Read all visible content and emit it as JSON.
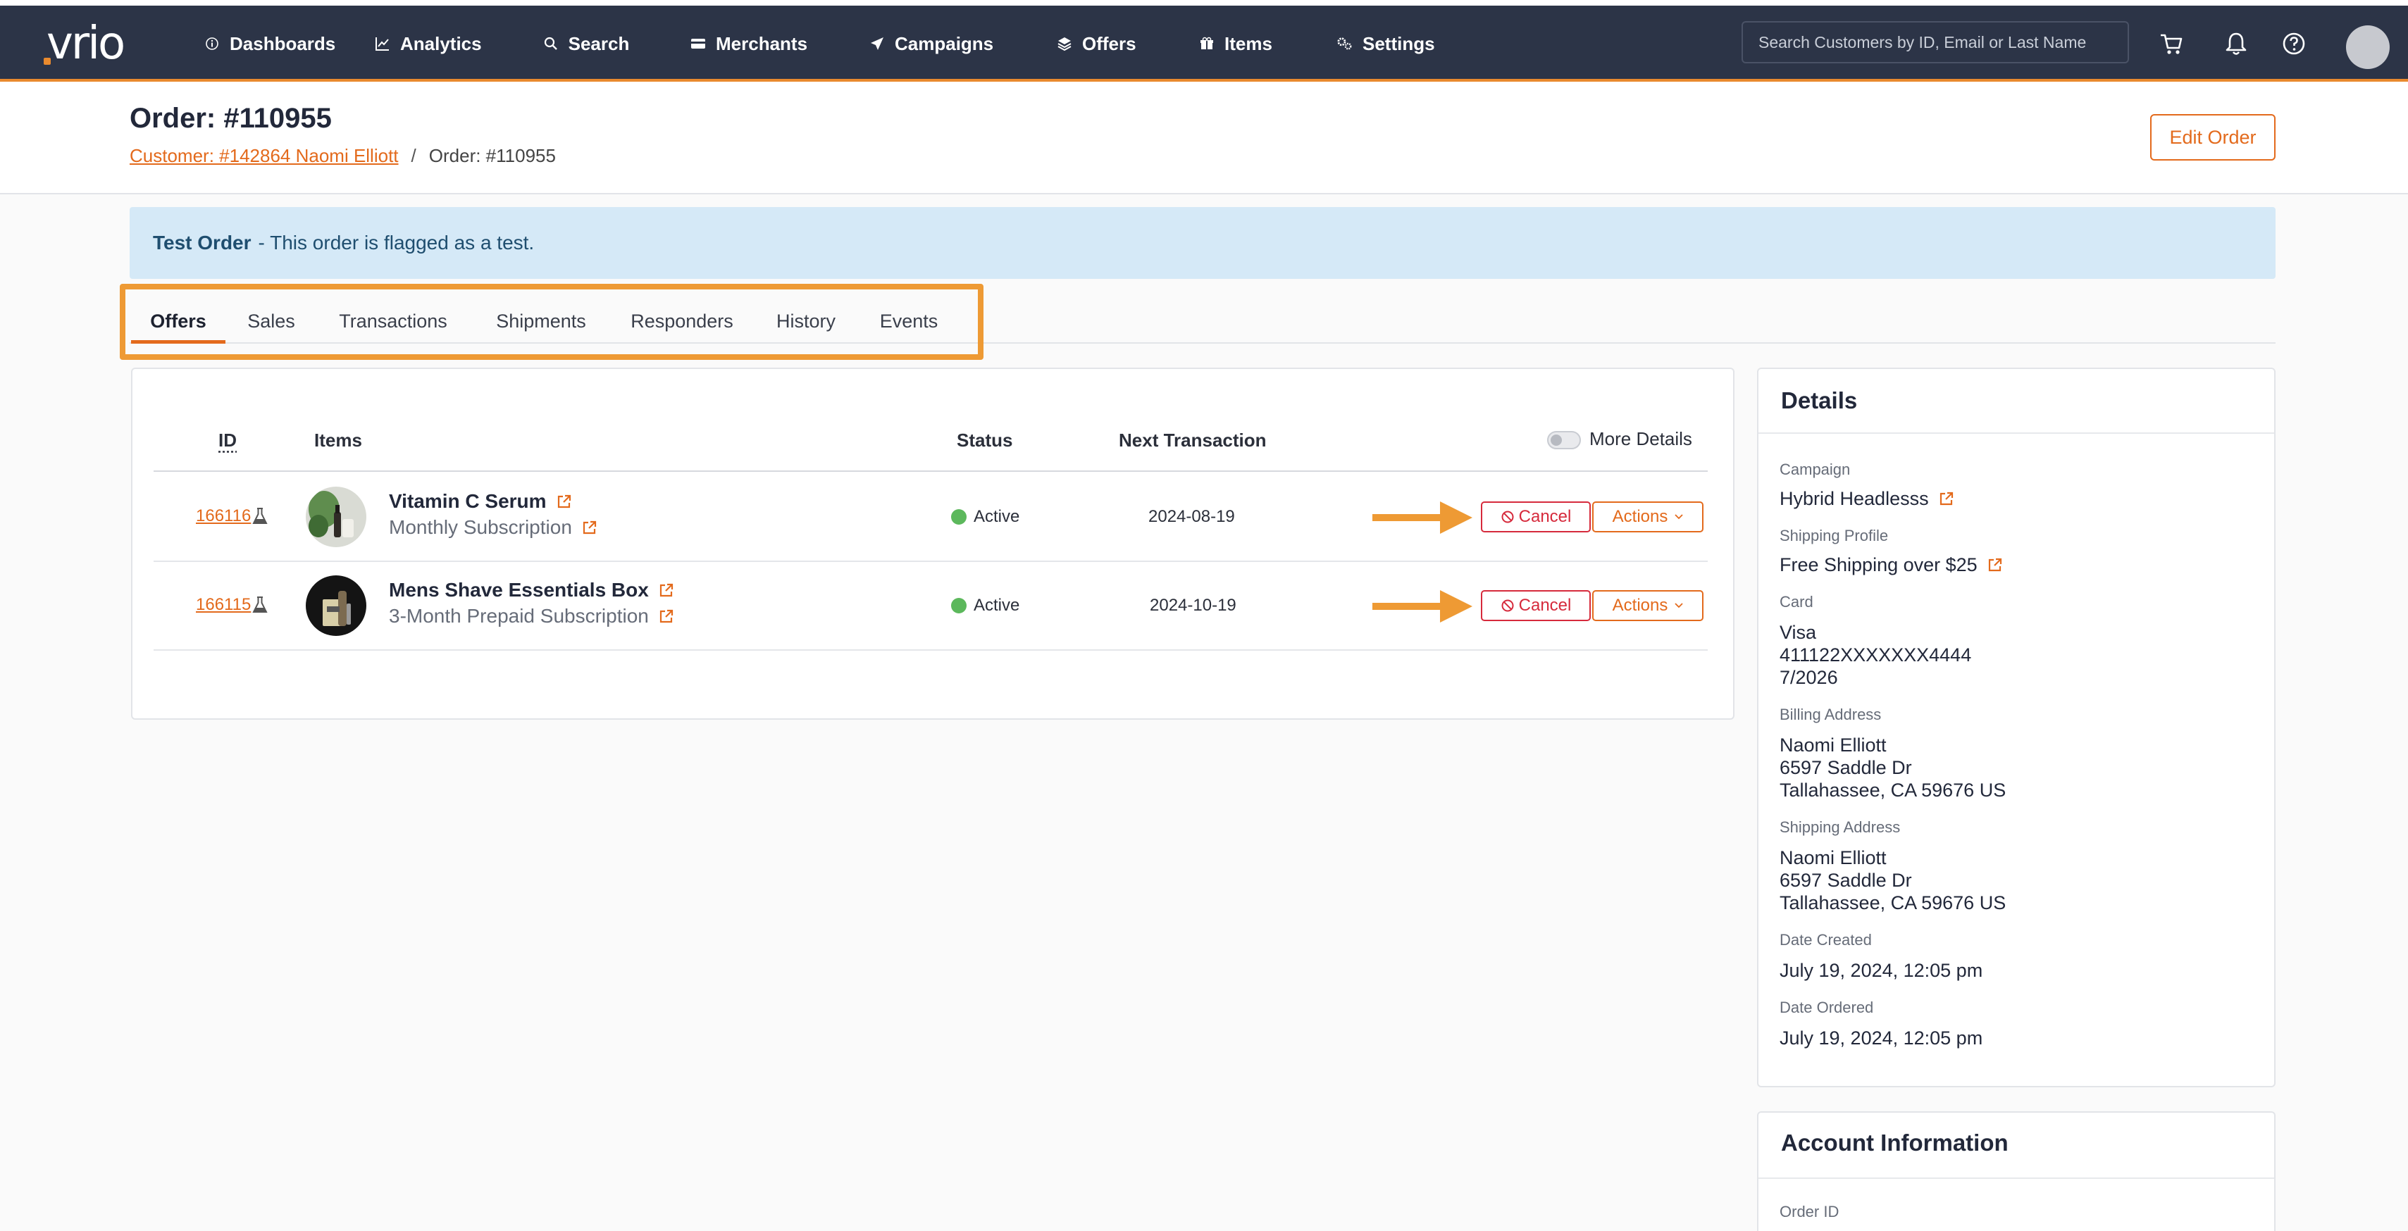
{
  "nav": {
    "logo": "vrio",
    "items": [
      {
        "label": "Dashboards",
        "icon": "info-circle-icon"
      },
      {
        "label": "Analytics",
        "icon": "line-chart-icon"
      },
      {
        "label": "Search",
        "icon": "search-icon"
      },
      {
        "label": "Merchants",
        "icon": "credit-card-icon"
      },
      {
        "label": "Campaigns",
        "icon": "paper-plane-icon"
      },
      {
        "label": "Offers",
        "icon": "layers-icon"
      },
      {
        "label": "Items",
        "icon": "gift-icon"
      },
      {
        "label": "Settings",
        "icon": "gears-icon"
      }
    ],
    "active": "Search",
    "search_placeholder": "Search Customers by ID, Email or Last Name"
  },
  "header": {
    "title": "Order: #110955",
    "breadcrumb_customer": "Customer: #142864 Naomi Elliott",
    "breadcrumb_separator": "/",
    "breadcrumb_current": "Order: #110955",
    "edit_label": "Edit Order"
  },
  "alert": {
    "bold": "Test Order",
    "text": "- This order is flagged as a test."
  },
  "tabs": [
    "Offers",
    "Sales",
    "Transactions",
    "Shipments",
    "Responders",
    "History",
    "Events"
  ],
  "active_tab": "Offers",
  "offers_table": {
    "headers": {
      "id": "ID",
      "items": "Items",
      "status": "Status",
      "next": "Next Transaction"
    },
    "more_details": "More Details",
    "rows": [
      {
        "id": "166116",
        "name": "Vitamin C Serum",
        "subscription": "Monthly Subscription",
        "status": "Active",
        "next": "2024-08-19",
        "cancel": "Cancel",
        "actions": "Actions"
      },
      {
        "id": "166115",
        "name": "Mens Shave Essentials Box",
        "subscription": "3-Month Prepaid Subscription",
        "status": "Active",
        "next": "2024-10-19",
        "cancel": "Cancel",
        "actions": "Actions"
      }
    ]
  },
  "details": {
    "title": "Details",
    "campaign_label": "Campaign",
    "campaign": "Hybrid Headlesss",
    "shipping_profile_label": "Shipping Profile",
    "shipping_profile": "Free Shipping over $25",
    "card_label": "Card",
    "card_type": "Visa",
    "card_number": "411122XXXXXXX4444",
    "card_exp": "7/2026",
    "billing_label": "Billing Address",
    "billing_name": "Naomi Elliott",
    "billing_street": "6597 Saddle Dr",
    "billing_city": "Tallahassee, CA 59676 US",
    "shipping_label": "Shipping Address",
    "shipping_name": "Naomi Elliott",
    "shipping_street": "6597 Saddle Dr",
    "shipping_city": "Tallahassee, CA 59676 US",
    "created_label": "Date Created",
    "created": "July 19, 2024, 12:05 pm",
    "ordered_label": "Date Ordered",
    "ordered": "July 19, 2024, 12:05 pm"
  },
  "account": {
    "title": "Account Information",
    "order_id_label": "Order ID"
  },
  "colors": {
    "nav_bg": "#2c3447",
    "accent": "#e36a1c",
    "highlight": "#ee9a34",
    "danger": "#d62a3c",
    "success": "#5cb85c",
    "alert_bg": "#d5e9f7"
  }
}
